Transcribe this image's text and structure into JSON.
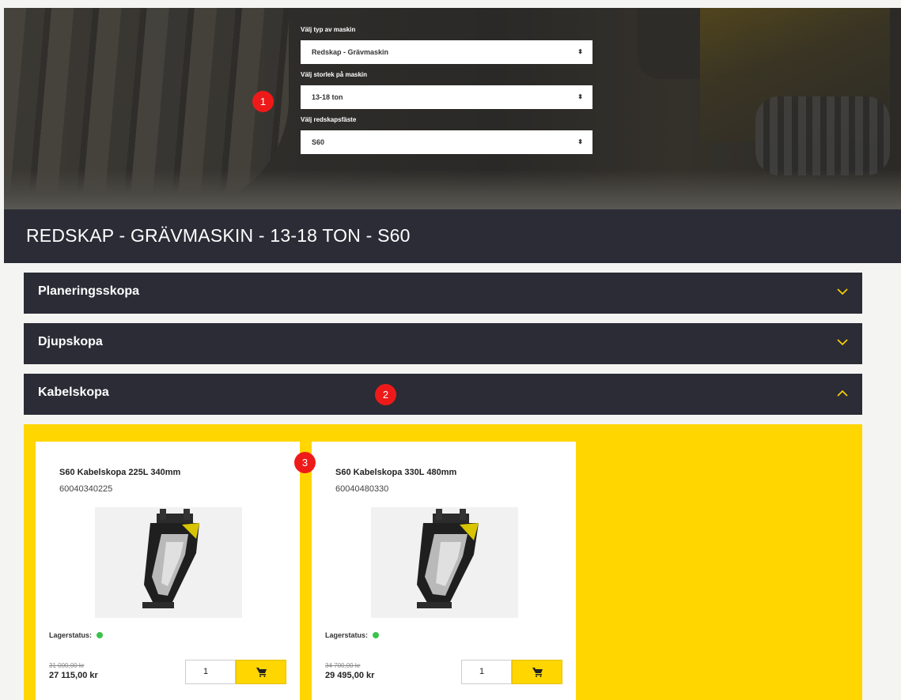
{
  "colors": {
    "accent": "#ffd600",
    "dark": "#2b2c36",
    "marker": "#ee1a1a",
    "stock_ok": "#3cc24a"
  },
  "filters": [
    {
      "label": "Välj typ av maskin",
      "value": "Redskap - Grävmaskin"
    },
    {
      "label": "Välj storlek på maskin",
      "value": "13-18 ton"
    },
    {
      "label": "Välj redskapsfäste",
      "value": "S60"
    }
  ],
  "page_title": "REDSKAP - GRÄVMASKIN - 13-18 TON - S60",
  "categories": [
    {
      "label": "Planeringsskopa",
      "expanded": false,
      "icon": "chevron-down-icon"
    },
    {
      "label": "Djupskopa",
      "expanded": false,
      "icon": "chevron-down-icon"
    },
    {
      "label": "Kabelskopa",
      "expanded": true,
      "icon": "chevron-up-icon"
    }
  ],
  "products": [
    {
      "name": "S60 Kabelskopa 225L 340mm",
      "number": "60040340225",
      "stock_label": "Lagerstatus:",
      "old_price": "31 000,00 kr",
      "price": "27 115,00 kr",
      "qty": "1",
      "cart_icon": "cart-icon"
    },
    {
      "name": "S60 Kabelskopa 330L 480mm",
      "number": "60040480330",
      "stock_label": "Lagerstatus:",
      "old_price": "34 700,00 kr",
      "price": "29 495,00 kr",
      "qty": "1",
      "cart_icon": "cart-icon"
    }
  ],
  "markers": [
    "1",
    "2",
    "3"
  ]
}
